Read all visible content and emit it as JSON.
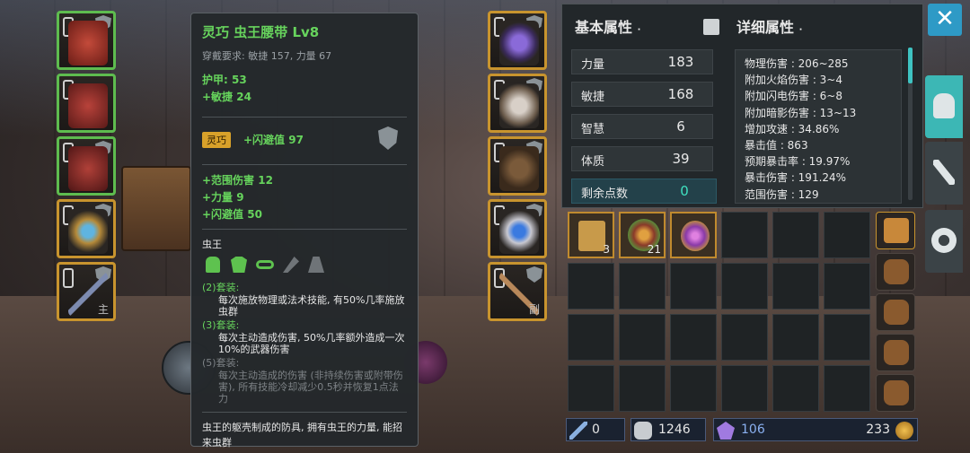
{
  "tooltip": {
    "title": "灵巧 虫王腰带 Lv8",
    "requirement": "穿戴要求:  敏捷 157, 力量 67",
    "armor": "护甲:  53",
    "agility_bonus": "+敏捷 24",
    "tag": "灵巧",
    "tag_bonus": "+闪避值 97",
    "bonus_1": "+范围伤害 12",
    "bonus_2": "+力量 9",
    "bonus_3": "+闪避值 50",
    "set_name": "虫王",
    "set2_head": "(2)套装:",
    "set2_text": "每次施放物理或法术技能, 有50%几率施放虫群",
    "set3_head": "(3)套装:",
    "set3_text": "每次主动造成伤害, 50%几率额外造成一次10%的武器伤害",
    "set5_head": "(5)套装:",
    "set5_text": "每次主动造成的伤害 (非持续伤害或附带伤害), 所有技能冷却减少0.5秒并恢复1点法力",
    "flavor": "虫王的躯壳制成的防具, 拥有虫王的力量, 能招来虫群"
  },
  "equipment": {
    "left_sub": "主",
    "right_sub": "副"
  },
  "basic": {
    "title": "基本属性",
    "stats": [
      {
        "label": "力量",
        "value": "183"
      },
      {
        "label": "敏捷",
        "value": "168"
      },
      {
        "label": "智慧",
        "value": "6"
      },
      {
        "label": "体质",
        "value": "39"
      }
    ],
    "free_label": "剩余点数",
    "free_value": "0"
  },
  "detail": {
    "title": "详细属性",
    "lines": [
      "物理伤害 : 206~285",
      "附加火焰伤害 : 3~4",
      "附加闪电伤害 : 6~8",
      "附加暗影伤害 : 13~13",
      "增加攻速 : 34.86%",
      "暴击值 : 863",
      "预期暴击率 : 19.97%",
      "暴击伤害 : 191.24%",
      "范围伤害 : 129"
    ]
  },
  "inventory": {
    "items": [
      {
        "qty": "3"
      },
      {
        "qty": "21"
      },
      {
        "qty": ""
      }
    ]
  },
  "currency": {
    "sword": "0",
    "bag": "1246",
    "crystal": "106",
    "gold": "233"
  },
  "colors": {
    "accent": "#3cb7b5",
    "green_text": "#67d45d",
    "gold_border": "#c8942e"
  },
  "icons": {
    "close": "close-icon",
    "helmet": "helmet-tab-icon",
    "weapons": "weapons-tab-icon",
    "settings": "settings-tab-icon"
  }
}
